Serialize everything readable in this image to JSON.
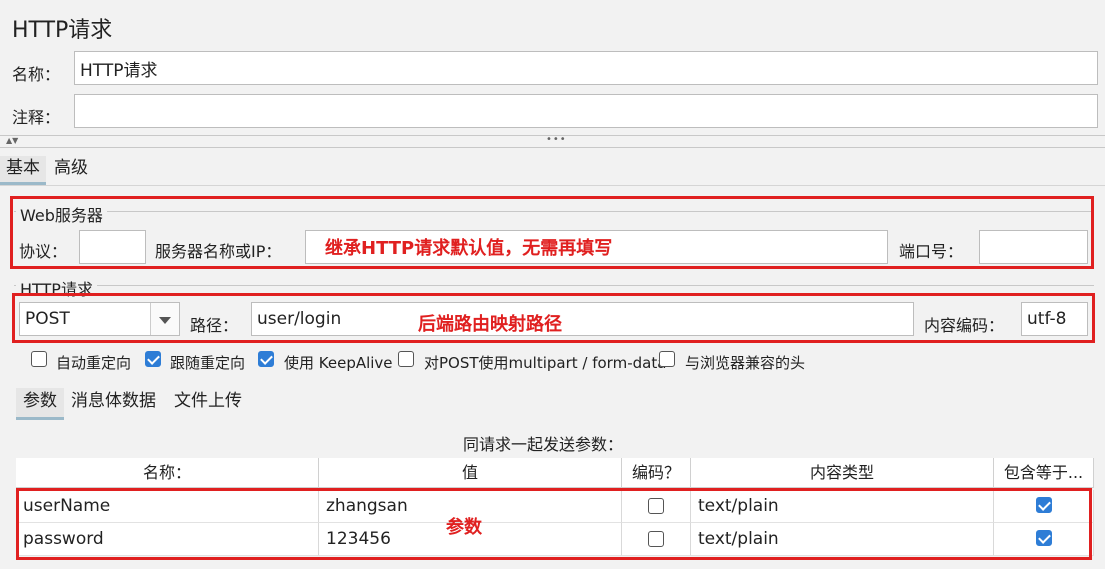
{
  "header": {
    "title": "HTTP请求"
  },
  "form": {
    "name_label": "名称：",
    "name_value": "HTTP请求",
    "comment_label": "注释：",
    "comment_value": ""
  },
  "splitter": {
    "arrows": "▲▼",
    "handle": "•••"
  },
  "tabs": [
    {
      "label": "基本"
    },
    {
      "label": "高级"
    }
  ],
  "web_server": {
    "title": "Web服务器",
    "protocol_label": "协议：",
    "protocol_value": "",
    "server_label": "服务器名称或IP：",
    "server_value": "",
    "port_label": "端口号：",
    "port_value": ""
  },
  "http_request": {
    "title": "HTTP请求",
    "method": "POST",
    "path_label": "路径：",
    "path_value": "user/login",
    "encoding_label": "内容编码：",
    "encoding_value": "utf-8"
  },
  "options": [
    {
      "label": "自动重定向",
      "checked": false
    },
    {
      "label": "跟随重定向",
      "checked": true
    },
    {
      "label": "使用 KeepAlive",
      "checked": true
    },
    {
      "label": "对POST使用multipart / form-data",
      "checked": false
    },
    {
      "label": "与浏览器兼容的头",
      "checked": false
    }
  ],
  "subtabs": [
    {
      "label": "参数"
    },
    {
      "label": "消息体数据"
    },
    {
      "label": "文件上传"
    }
  ],
  "params": {
    "caption": "同请求一起发送参数：",
    "columns": [
      "名称：",
      "值",
      "编码？",
      "内容类型",
      "包含等于..."
    ],
    "rows": [
      {
        "name": "userName",
        "value": "zhangsan",
        "encode": false,
        "content_type": "text/plain",
        "include_equals": true
      },
      {
        "name": "password",
        "value": "123456",
        "encode": false,
        "content_type": "text/plain",
        "include_equals": true
      }
    ]
  },
  "annotations": {
    "server_note": "继承HTTP请求默认值，无需再填写",
    "path_note": "后端路由映射路径",
    "params_note": "参数",
    "color": "#e02020"
  }
}
